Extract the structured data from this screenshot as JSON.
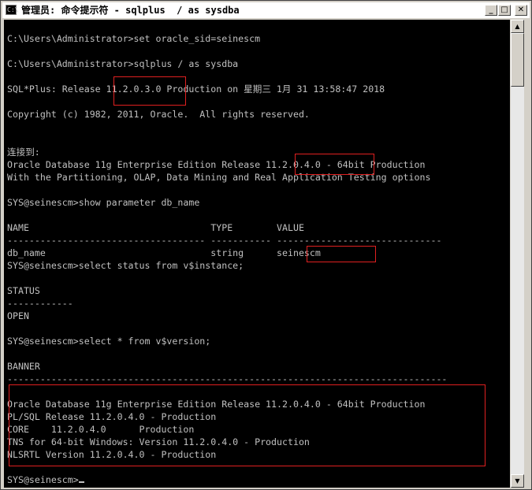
{
  "window": {
    "title": "管理员: 命令提示符 - sqlplus  / as sysdba",
    "icon": "cmd-icon",
    "controls": {
      "minimize": "minimize-icon",
      "maximize": "maximize-icon",
      "close": "close-icon"
    }
  },
  "console": {
    "text_color": "#c0c0c0",
    "background": "#000000",
    "highlight_color": "#e02020",
    "lines": [
      "C:\\Users\\Administrator>set oracle_sid=seinescm",
      "",
      "C:\\Users\\Administrator>sqlplus / as sysdba",
      "",
      "SQL*Plus: Release 11.2.0.3.0 Production on 星期三 1月 31 13:58:47 2018",
      "",
      "Copyright (c) 1982, 2011, Oracle.  All rights reserved.",
      "",
      "",
      "连接到:",
      "Oracle Database 11g Enterprise Edition Release 11.2.0.4.0 - 64bit Production",
      "With the Partitioning, OLAP, Data Mining and Real Application Testing options",
      "",
      "SYS@seinescm>show parameter db_name",
      "",
      "NAME                                 TYPE        VALUE",
      "------------------------------------ ----------- ------------------------------",
      "db_name                              string      seinescm",
      "SYS@seinescm>select status from v$instance;",
      "",
      "STATUS",
      "------------",
      "OPEN",
      "",
      "SYS@seinescm>select * from v$version;",
      "",
      "BANNER",
      "--------------------------------------------------------------------------------",
      "",
      "Oracle Database 11g Enterprise Edition Release 11.2.0.4.0 - 64bit Production",
      "PL/SQL Release 11.2.0.4.0 - Production",
      "CORE    11.2.0.4.0      Production",
      "TNS for 64-bit Windows: Version 11.2.0.4.0 - Production",
      "NLSRTL Version 11.2.0.4.0 - Production",
      "",
      "SYS@seinescm>"
    ]
  },
  "scrollbar": {
    "up": "scroll-up-arrow-icon",
    "down": "scroll-down-arrow-icon"
  }
}
